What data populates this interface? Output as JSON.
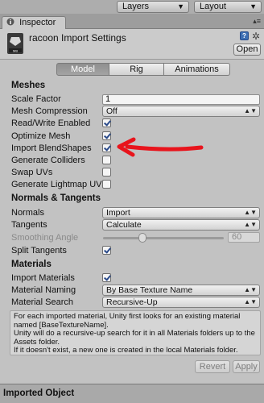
{
  "toolbar": {
    "layers": "Layers",
    "layout": "Layout"
  },
  "tab": {
    "label": "Inspector"
  },
  "header": {
    "title": "racoon Import Settings",
    "open": "Open"
  },
  "tabs": [
    "Model",
    "Rig",
    "Animations"
  ],
  "meshes": {
    "heading": "Meshes",
    "scale_factor_label": "Scale Factor",
    "scale_factor_value": "1",
    "mesh_compression_label": "Mesh Compression",
    "mesh_compression_value": "Off",
    "read_write_label": "Read/Write Enabled",
    "optimize_label": "Optimize Mesh",
    "blendshapes_label": "Import BlendShapes",
    "colliders_label": "Generate Colliders",
    "swapuvs_label": "Swap UVs",
    "lightmapuvs_label": "Generate Lightmap UVs"
  },
  "normals": {
    "heading": "Normals & Tangents",
    "normals_label": "Normals",
    "normals_value": "Import",
    "tangents_label": "Tangents",
    "tangents_value": "Calculate",
    "smoothing_label": "Smoothing Angle",
    "smoothing_value": "60",
    "split_label": "Split Tangents"
  },
  "materials": {
    "heading": "Materials",
    "import_label": "Import Materials",
    "naming_label": "Material Naming",
    "naming_value": "By Base Texture Name",
    "search_label": "Material Search",
    "search_value": "Recursive-Up",
    "help_line1": "For each imported material, Unity first looks for an existing material",
    "help_line2": "named [BaseTextureName].",
    "help_line3": "Unity will do a recursive-up search for it in all Materials folders up to the",
    "help_line4": "Assets folder.",
    "help_line5": "If it doesn't exist, a new one is created in the local Materials folder."
  },
  "buttons": {
    "revert": "Revert",
    "apply": "Apply"
  },
  "footer": {
    "title": "Imported Object"
  },
  "checkboxes": {
    "read_write": true,
    "optimize": true,
    "blendshapes": true,
    "colliders": false,
    "swapuvs": false,
    "lightmapuvs": false,
    "split_tangents": true,
    "import_materials": true
  },
  "colors": {
    "annotation_arrow": "#e8141c",
    "active_tab": "#9a9a9a"
  }
}
